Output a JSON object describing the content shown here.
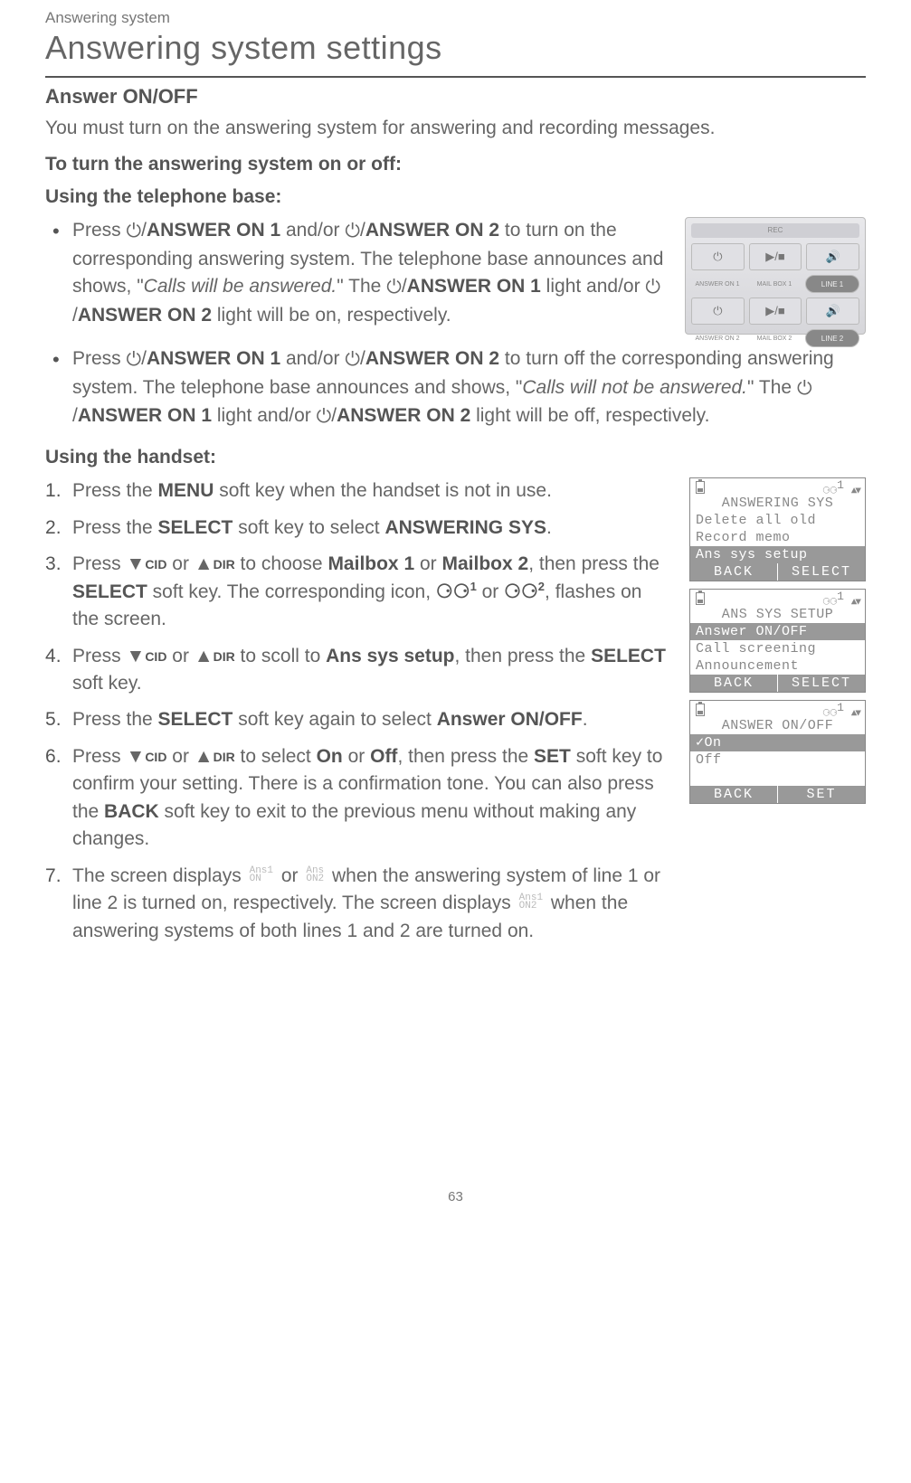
{
  "breadcrumb": "Answering system",
  "title": "Answering system settings",
  "section_heading": "Answer ON/OFF",
  "intro": "You must turn on the answering system for answering and recording messages.",
  "sub1": "To turn the answering system on or off:",
  "sub_base": "Using the telephone base:",
  "base_bullets": {
    "b1_a": "Press ",
    "b1_b": "ANSWER ON 1",
    "b1_c": " and/or ",
    "b1_d": "ANSWER ON 2",
    "b1_e": " to turn on the corresponding answering system. The telephone base announces and shows, \"",
    "b1_f": "Calls will be answered.",
    "b1_g": "\" The ",
    "b1_h": "ANSWER ON 1",
    "b1_i": " light and/or ",
    "b1_j": "ANSWER ON 2",
    "b1_k": " light will be on, respectively.",
    "b2_a": "Press ",
    "b2_b": "ANSWER ON 1",
    "b2_c": " and/or ",
    "b2_d": "ANSWER ON 2",
    "b2_e": " to turn off the corresponding answering system. The telephone base announces and shows, \"",
    "b2_f": "Calls will not be answered.",
    "b2_g": "\" The ",
    "b2_h": "ANSWER ON 1",
    "b2_i": " light and/or ",
    "b2_j": "ANSWER ON 2",
    "b2_k": " light will be off, respectively."
  },
  "sub_handset": "Using the handset:",
  "steps": {
    "s1_a": "Press the ",
    "s1_b": "MENU",
    "s1_c": " soft key when the handset is not in use.",
    "s2_a": "Press the ",
    "s2_b": "SELECT",
    "s2_c": " soft key to select ",
    "s2_d": "ANSWERING SYS",
    "s2_e": ".",
    "s3_a": "Press ",
    "s3_b": "CID",
    "s3_c": " or ",
    "s3_d": "DIR",
    "s3_e": " to choose ",
    "s3_f": "Mailbox 1",
    "s3_g": " or ",
    "s3_h": "Mailbox 2",
    "s3_i": ", then press the ",
    "s3_j": "SELECT",
    "s3_k": " soft key. The corresponding icon, ",
    "s3_l": "1",
    "s3_m": " or ",
    "s3_n": "2",
    "s3_o": ", flashes on the screen.",
    "s4_a": "Press ",
    "s4_b": "CID",
    "s4_c": " or ",
    "s4_d": "DIR",
    "s4_e": " to scoll to ",
    "s4_f": "Ans sys setup",
    "s4_g": ", then press the ",
    "s4_h": "SELECT",
    "s4_i": " soft key.",
    "s5_a": "Press the ",
    "s5_b": "SELECT",
    "s5_c": " soft key again to select ",
    "s5_d": "Answer ON/OFF",
    "s5_e": ".",
    "s6_a": "Press ",
    "s6_b": "CID",
    "s6_c": " or ",
    "s6_d": "DIR",
    "s6_e": " to select ",
    "s6_f": "On",
    "s6_g": " or ",
    "s6_h": "Off",
    "s6_i": ", then press the ",
    "s6_j": "SET",
    "s6_k": " soft key to confirm your setting. There is a confirmation tone. You can also press the ",
    "s6_l": "BACK",
    "s6_m": " soft key to exit to the previous menu without making any changes.",
    "s7_a": "The screen displays ",
    "s7_b": " or ",
    "s7_c": " when the answering system of line 1 or line 2 is turned on, respectively. The screen displays ",
    "s7_d": " when the answering systems of both lines 1 and 2 are turned on."
  },
  "tags": {
    "t1_top": "Ans1",
    "t1_bot": "ON",
    "t2_top": "Ans",
    "t2_bot": "ON2",
    "t3_top": "Ans1",
    "t3_bot": "ON2"
  },
  "base_panel": {
    "rec": "REC",
    "labels": {
      "a1": "ANSWER ON 1",
      "mb1": "MAIL BOX 1",
      "l1": "LINE 1",
      "a2": "ANSWER ON 2",
      "mb2": "MAIL BOX 2",
      "l2": "LINE 2"
    }
  },
  "lcd1": {
    "title": "ANSWERING SYS",
    "l1": "Delete all old",
    "l2": "Record memo",
    "hl": "Ans sys setup",
    "soft_left": "BACK",
    "soft_right": "SELECT",
    "tape_sup": "1"
  },
  "lcd2": {
    "title": "ANS SYS SETUP",
    "hl": "Answer ON/OFF",
    "l1": "Call screening",
    "l2": "Announcement",
    "soft_left": "BACK",
    "soft_right": "SELECT",
    "tape_sup": "1"
  },
  "lcd3": {
    "title": "ANSWER ON/OFF",
    "hl": "✓On",
    "l1": " Off",
    "l2": " ",
    "soft_left": "BACK",
    "soft_right": "SET",
    "tape_sup": "1"
  },
  "page_num": "63",
  "glyphs": {
    "power": "⏻",
    "down": "▼",
    "up": "▲",
    "tape": "⚆⚆",
    "play": "▶/■",
    "vol": "🔊"
  }
}
